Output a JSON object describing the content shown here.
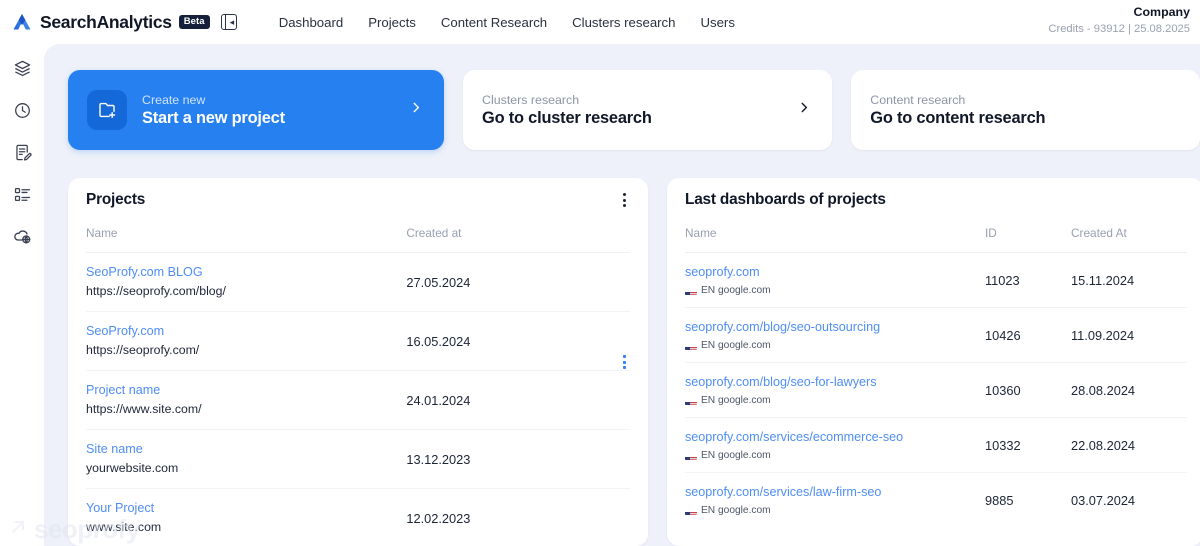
{
  "brand": {
    "name": "SearchAnalytics",
    "badge": "Beta",
    "logo_icon": "searchanalytics-logo-icon",
    "toggle_icon": "panel-collapse-icon"
  },
  "topnav": {
    "items": [
      {
        "label": "Dashboard"
      },
      {
        "label": "Projects"
      },
      {
        "label": "Content Research"
      },
      {
        "label": "Clusters research"
      },
      {
        "label": "Users"
      }
    ]
  },
  "account": {
    "company": "Company",
    "credits": "Credits - 93912 | 25.08.2025"
  },
  "sidebar": {
    "items": [
      {
        "icon": "layers-icon"
      },
      {
        "icon": "clock-history-icon"
      },
      {
        "icon": "document-edit-icon"
      },
      {
        "icon": "task-list-icon"
      },
      {
        "icon": "cloud-globe-icon"
      }
    ]
  },
  "hero": {
    "cards": [
      {
        "eyebrow": "Create new",
        "title": "Start a new project",
        "icon": "folder-plus-icon",
        "chevron": "chevron-right-icon",
        "primary": true
      },
      {
        "eyebrow": "Clusters research",
        "title": "Go to cluster research",
        "chevron": "chevron-right-icon",
        "primary": false
      },
      {
        "eyebrow": "Content research",
        "title": "Go to content research",
        "primary": false
      }
    ]
  },
  "projects_panel": {
    "title": "Projects",
    "menu_icon": "kebab-menu-icon",
    "columns": [
      "Name",
      "Created at"
    ],
    "rows": [
      {
        "name": "SeoProfy.com BLOG",
        "url": "https://seoprofy.com/blog/",
        "created_at": "27.05.2024"
      },
      {
        "name": "SeoProfy.com",
        "url": "https://seoprofy.com/",
        "created_at": "16.05.2024"
      },
      {
        "name": "Project name",
        "url": "https://www.site.com/",
        "created_at": "24.01.2024"
      },
      {
        "name": "Site name",
        "url": "yourwebsite.com",
        "created_at": "13.12.2023"
      },
      {
        "name": "Your Project",
        "url": "www.site.com",
        "created_at": "12.02.2023"
      }
    ]
  },
  "dashboards_panel": {
    "title": "Last dashboards of projects",
    "columns": [
      "Name",
      "ID",
      "Created At"
    ],
    "rows": [
      {
        "name": "seoprofy.com",
        "locale": "EN google.com",
        "flag": "us-flag-icon",
        "id": "11023",
        "created_at": "15.11.2024"
      },
      {
        "name": "seoprofy.com/blog/seo-outsourcing",
        "locale": "EN google.com",
        "flag": "us-flag-icon",
        "id": "10426",
        "created_at": "11.09.2024"
      },
      {
        "name": "seoprofy.com/blog/seo-for-lawyers",
        "locale": "EN google.com",
        "flag": "us-flag-icon",
        "id": "10360",
        "created_at": "28.08.2024"
      },
      {
        "name": "seoprofy.com/services/ecommerce-seo",
        "locale": "EN google.com",
        "flag": "us-flag-icon",
        "id": "10332",
        "created_at": "22.08.2024"
      },
      {
        "name": "seoprofy.com/services/law-firm-seo",
        "locale": "EN google.com",
        "flag": "us-flag-icon",
        "id": "9885",
        "created_at": "03.07.2024"
      }
    ]
  },
  "watermark": {
    "text": "seoprofy",
    "icon": "arrow-up-right-icon"
  },
  "colors": {
    "accent_blue": "#2680f0",
    "link_blue": "#4f8ef4",
    "surface": "#eef1f9",
    "text_dark": "#101828",
    "text_muted": "#98a1b0",
    "badge_dark": "#16203a"
  }
}
